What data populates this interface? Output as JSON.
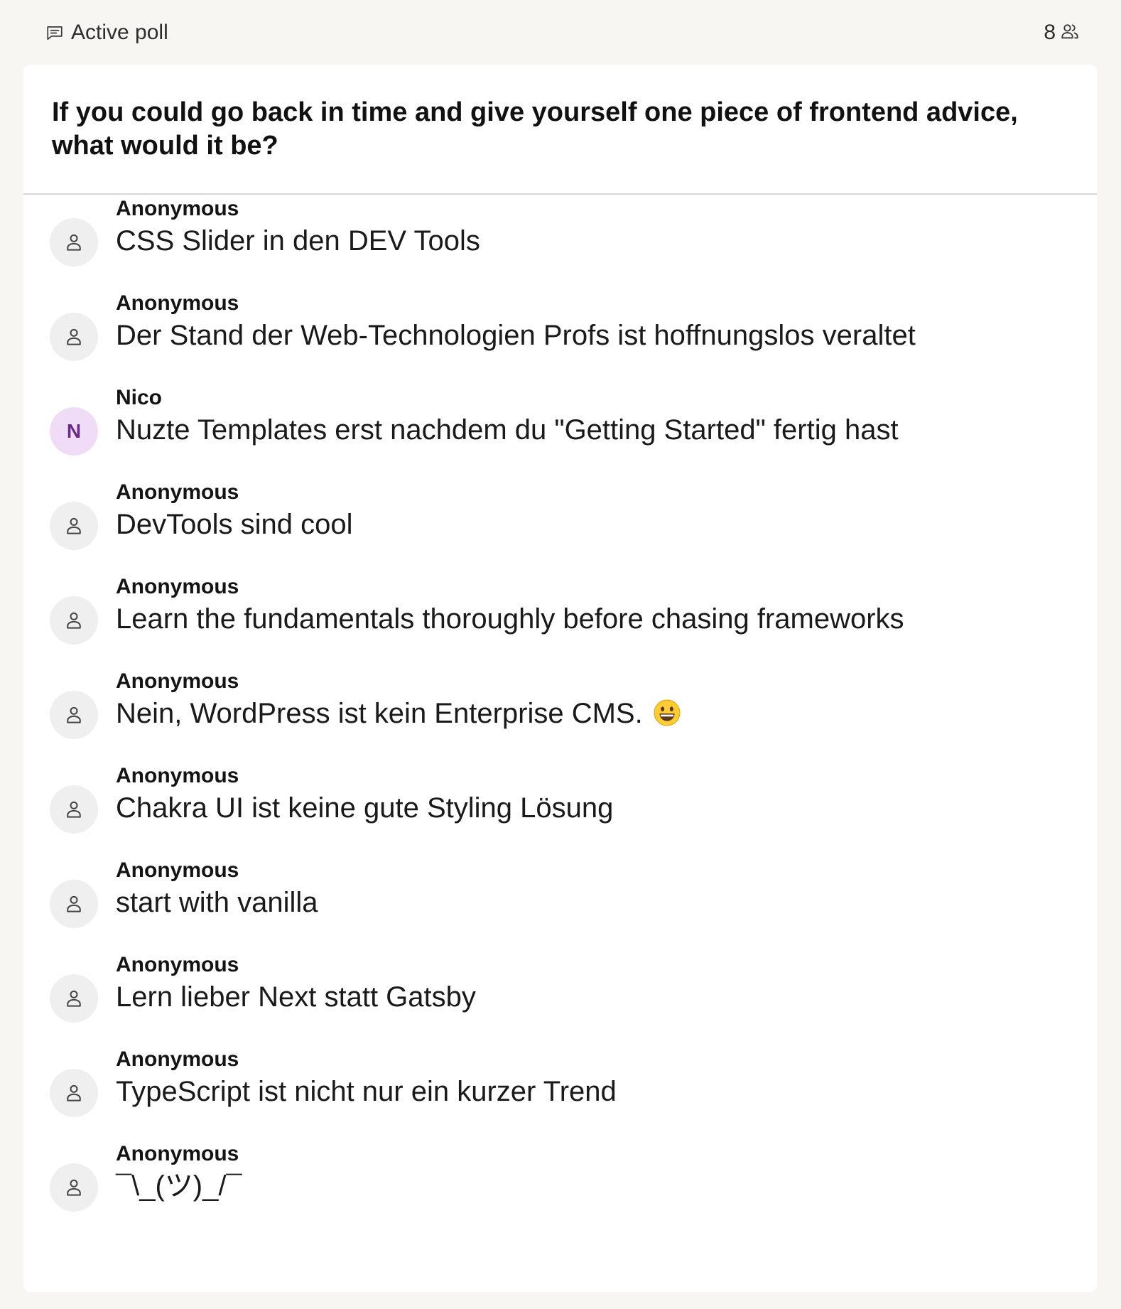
{
  "header": {
    "title": "Active poll",
    "title_icon": "message-square-icon",
    "participant_count": "8",
    "participant_icon": "users-icon"
  },
  "poll": {
    "question": "If you could go back in time and give yourself one piece of frontend advice, what would it be?"
  },
  "responses": [
    {
      "author": "Anonymous",
      "avatar": "user-icon",
      "text": "CSS Slider in den DEV Tools"
    },
    {
      "author": "Anonymous",
      "avatar": "user-icon",
      "text": "Der Stand der Web-Technologien Profs ist hoffnungslos veraltet"
    },
    {
      "author": "Nico",
      "avatar_initial": "N",
      "text": "Nuzte Templates erst nachdem du \"Getting Started\" fertig hast"
    },
    {
      "author": "Anonymous",
      "avatar": "user-icon",
      "text": "DevTools sind cool"
    },
    {
      "author": "Anonymous",
      "avatar": "user-icon",
      "text": "Learn the fundamentals thoroughly before chasing frameworks"
    },
    {
      "author": "Anonymous",
      "avatar": "user-icon",
      "text": "Nein, WordPress ist kein Enterprise CMS.",
      "emoji": "grinning-face-icon"
    },
    {
      "author": "Anonymous",
      "avatar": "user-icon",
      "text": "Chakra UI ist keine gute Styling Lösung"
    },
    {
      "author": "Anonymous",
      "avatar": "user-icon",
      "text": "start with vanilla"
    },
    {
      "author": "Anonymous",
      "avatar": "user-icon",
      "text": "Lern lieber Next statt Gatsby"
    },
    {
      "author": "Anonymous",
      "avatar": "user-icon",
      "text": "TypeScript ist nicht nur ein kurzer Trend"
    },
    {
      "author": "Anonymous",
      "avatar": "user-icon",
      "text": "¯\\_(ツ)_/¯"
    }
  ],
  "colors": {
    "page_background": "#f8f6f2",
    "card_background": "#ffffff",
    "avatar_background": "#efefef",
    "initial_avatar_background": "#f1dcf7",
    "initial_avatar_text": "#6b2a88"
  }
}
